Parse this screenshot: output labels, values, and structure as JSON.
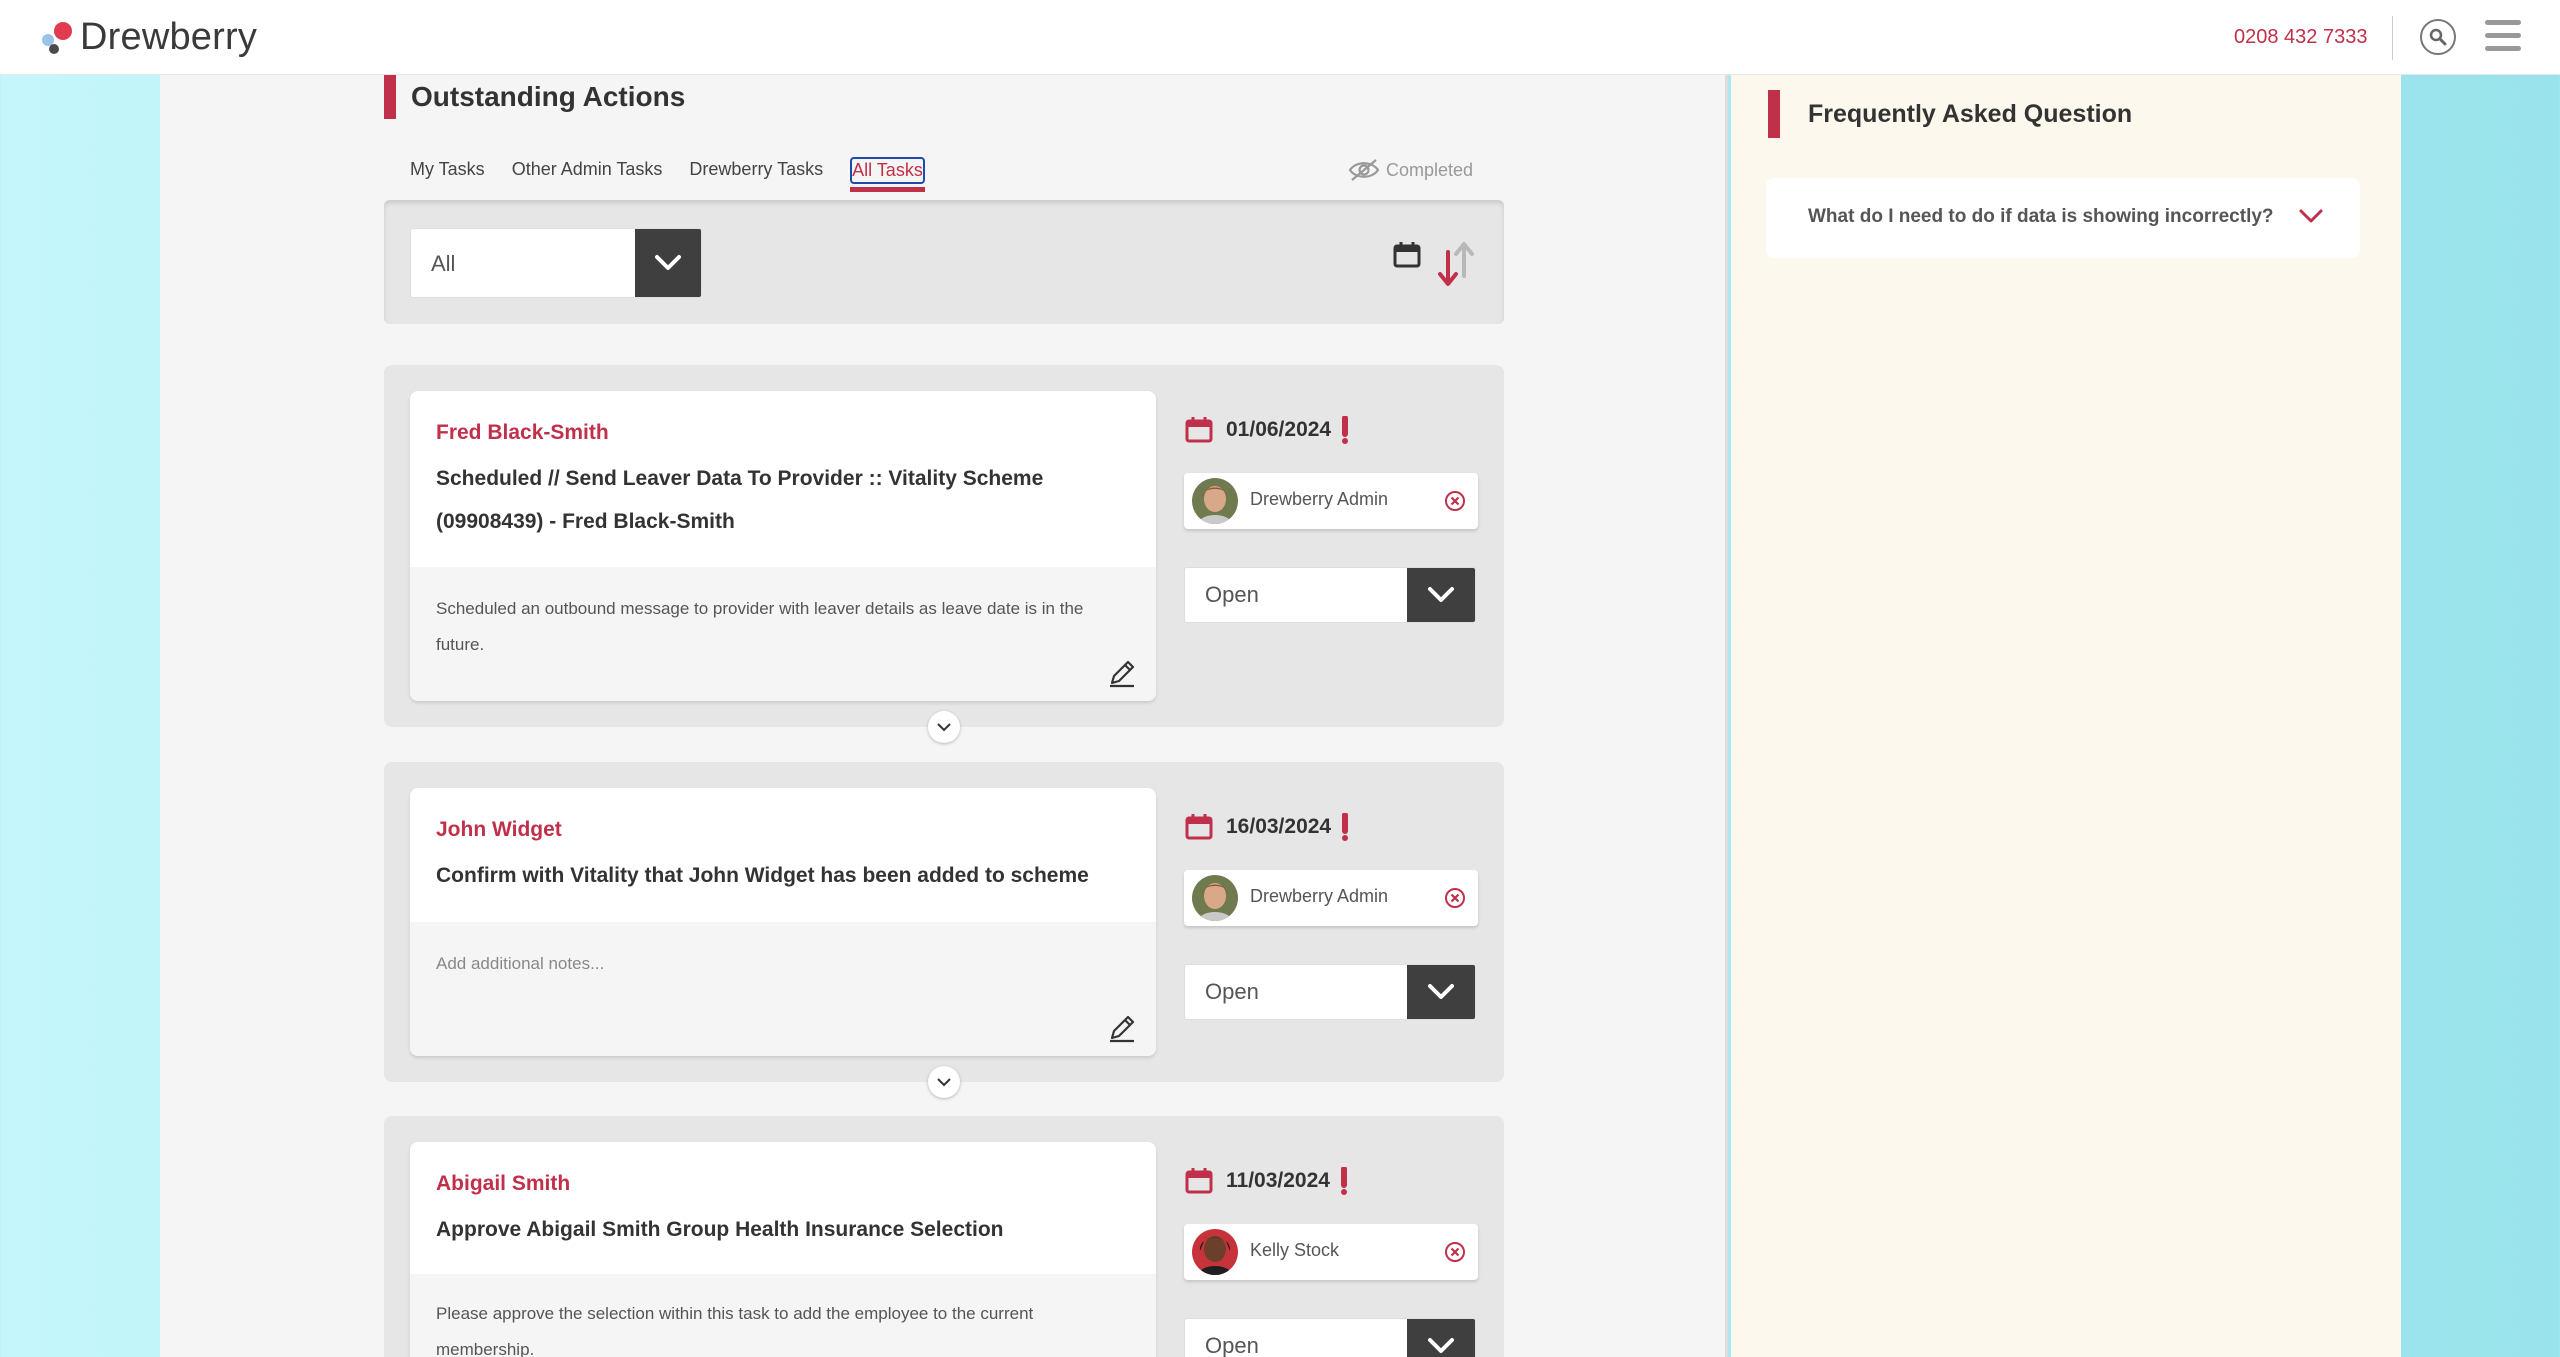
{
  "header": {
    "brand": "Drewberry",
    "phone": "0208 432 7333",
    "search_icon": "search-icon",
    "menu_icon": "hamburger-menu-icon"
  },
  "colors": {
    "accent": "#c1304a",
    "dark_button": "#3f3f3f",
    "panel": "#f5f5f5",
    "faq_panel": "#fdf8ee",
    "background": "#b3ecf3"
  },
  "main": {
    "title": "Outstanding Actions",
    "tabs": [
      {
        "label": "My Tasks",
        "active": false
      },
      {
        "label": "Other Admin Tasks",
        "active": false
      },
      {
        "label": "Drewberry Tasks",
        "active": false
      },
      {
        "label": "All Tasks",
        "active": true
      }
    ],
    "completed_label": "Completed",
    "filter": {
      "selected": "All"
    },
    "sort_icons": [
      "calendar-icon",
      "sort-arrows-icon"
    ],
    "tasks": [
      {
        "name": "Fred Black-Smith",
        "title": "Scheduled // Send Leaver Data To Provider :: Vitality Scheme (09908439) - Fred Black-Smith",
        "notes": "Scheduled an outbound message to provider with leaver details as leave date is in the future.",
        "due_date": "01/06/2024",
        "assignee": "Drewberry Admin",
        "status": "Open"
      },
      {
        "name": "John Widget",
        "title": "Confirm with Vitality that John Widget has been added to scheme",
        "notes": "Add additional notes...",
        "due_date": "16/03/2024",
        "assignee": "Drewberry Admin",
        "status": "Open"
      },
      {
        "name": "Abigail Smith",
        "title": "Approve Abigail Smith Group Health Insurance Selection",
        "notes": "Please approve the selection within this task to add the employee to the current membership.",
        "due_date": "11/03/2024",
        "assignee": "Kelly Stock",
        "status": "Open"
      }
    ]
  },
  "faq": {
    "title": "Frequently Asked Question",
    "items": [
      {
        "question": "What do I need to do if data is showing incorrectly?"
      }
    ]
  }
}
